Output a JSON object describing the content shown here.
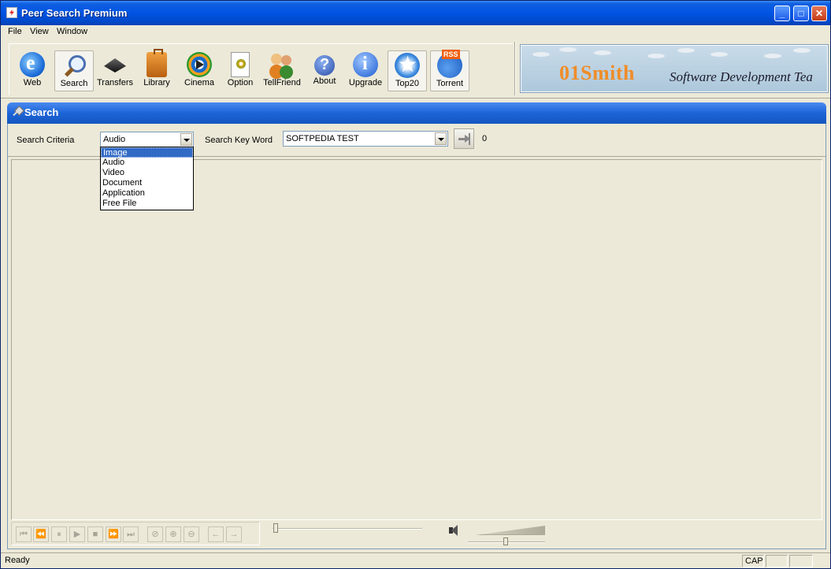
{
  "window": {
    "title": "Peer Search Premium",
    "buttons": {
      "minimize": "_",
      "maximize": "□",
      "close": "✕"
    }
  },
  "menu": [
    "File",
    "View",
    "Window"
  ],
  "toolbar": [
    {
      "label": "Web",
      "icon": "web-icon",
      "active": false
    },
    {
      "label": "Search",
      "icon": "search-icon",
      "active": true
    },
    {
      "label": "Transfers",
      "icon": "transfers-icon",
      "active": false
    },
    {
      "label": "Library",
      "icon": "library-icon",
      "active": false
    },
    {
      "label": "Cinema",
      "icon": "cinema-icon",
      "active": false
    },
    {
      "label": "Option",
      "icon": "option-icon",
      "active": false
    },
    {
      "label": "TellFriend",
      "icon": "tellfriend-icon",
      "active": false
    },
    {
      "label": "About",
      "icon": "about-icon",
      "active": false
    },
    {
      "label": "Upgrade",
      "icon": "upgrade-icon",
      "active": false
    },
    {
      "label": "Top20",
      "icon": "top20-icon",
      "active": true
    },
    {
      "label": "Torrent",
      "icon": "torrent-icon",
      "active": true
    }
  ],
  "banner": {
    "brand": "01Smith",
    "tagline": "Software Development Tea"
  },
  "search_panel": {
    "title": "Search",
    "criteria_label": "Search Criteria",
    "criteria_value": "Audio",
    "criteria_options": [
      "Image",
      "Audio",
      "Video",
      "Document",
      "Application",
      "Free File"
    ],
    "highlighted_option": "Image",
    "keyword_label": "Search Key Word",
    "keyword_value": "SOFTPEDIA TEST",
    "result_count": "0"
  },
  "player": {
    "buttons": [
      "⏮",
      "⏪",
      "⏸",
      "▶",
      "■",
      "⏩",
      "⏭"
    ],
    "zoom_buttons": [
      "⊘",
      "⊕",
      "⊖"
    ],
    "nav_buttons": [
      "←",
      "→"
    ]
  },
  "status": {
    "text": "Ready",
    "cap": "CAP"
  },
  "colors": {
    "titlebar": "#0054e3",
    "panel_header": "#1c64d8",
    "selection": "#316ac5",
    "banner_brand": "#f08c28"
  }
}
